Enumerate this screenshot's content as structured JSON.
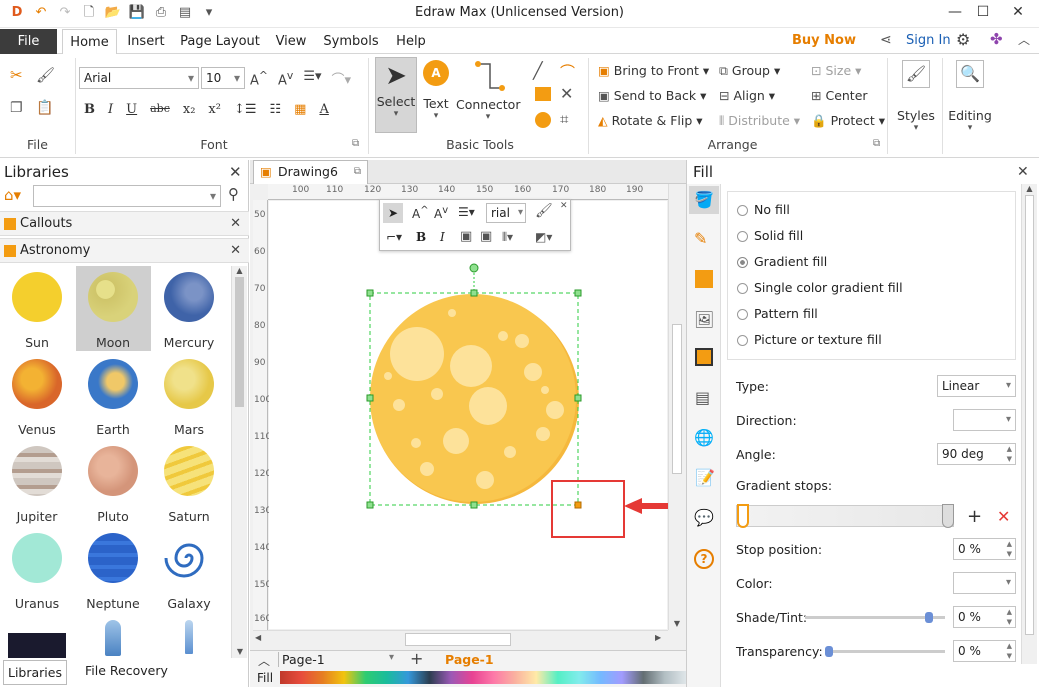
{
  "window": {
    "title": "Edraw Max (Unlicensed Version)"
  },
  "menu": {
    "file": "File",
    "tabs": [
      "Home",
      "Insert",
      "Page Layout",
      "View",
      "Symbols",
      "Help"
    ],
    "buy_now": "Buy Now",
    "sign_in": "Sign In"
  },
  "ribbon": {
    "font": {
      "family": "Arial",
      "size": "10",
      "label": "Font"
    },
    "file_label": "File",
    "basic_tools": {
      "select": "Select",
      "text": "Text",
      "connector": "Connector",
      "label": "Basic Tools"
    },
    "arrange": {
      "bring_front": "Bring to Front",
      "send_back": "Send to Back",
      "rotate_flip": "Rotate & Flip",
      "group": "Group",
      "align": "Align",
      "distribute": "Distribute",
      "size": "Size",
      "center": "Center",
      "protect": "Protect",
      "label": "Arrange"
    },
    "styles": "Styles",
    "editing": "Editing"
  },
  "libraries": {
    "title": "Libraries",
    "categories": [
      "Callouts",
      "Astronomy"
    ],
    "symbols": [
      "Sun",
      "Moon",
      "Mercury",
      "Venus",
      "Earth",
      "Mars",
      "Jupiter",
      "Pluto",
      "Saturn",
      "Uranus",
      "Neptune",
      "Galaxy"
    ],
    "bottom_tabs": [
      "Libraries",
      "File Recovery"
    ]
  },
  "document": {
    "tab": "Drawing6",
    "float_font": "rial"
  },
  "rulers": {
    "h": [
      "100",
      "110",
      "120",
      "130",
      "140",
      "150",
      "160",
      "170",
      "180",
      "190"
    ],
    "v": [
      "50",
      "60",
      "70",
      "80",
      "90",
      "100",
      "110",
      "120",
      "130",
      "140",
      "150",
      "160"
    ]
  },
  "status": {
    "page_select": "Page-1",
    "page_tab": "Page-1",
    "fill_label": "Fill"
  },
  "fill_panel": {
    "title": "Fill",
    "options": [
      "No fill",
      "Solid fill",
      "Gradient fill",
      "Single color gradient fill",
      "Pattern fill",
      "Picture or texture fill"
    ],
    "selected": "Gradient fill",
    "type_label": "Type:",
    "type_value": "Linear",
    "direction_label": "Direction:",
    "angle_label": "Angle:",
    "angle_value": "90 deg",
    "stops_label": "Gradient stops:",
    "stop_position_label": "Stop position:",
    "stop_position_value": "0 %",
    "color_label": "Color:",
    "shade_label": "Shade/Tint:",
    "shade_value": "0 %",
    "transparency_label": "Transparency:",
    "transparency_value": "0 %"
  },
  "colors": {
    "moon": "#f9c74f",
    "moon_shadow": "#f5b83d",
    "crater": "#fde29a",
    "accent": "#f39c12",
    "annotation": "#e53935",
    "buy_now": "#e67e00",
    "sign_in": "#1a5fb4"
  }
}
